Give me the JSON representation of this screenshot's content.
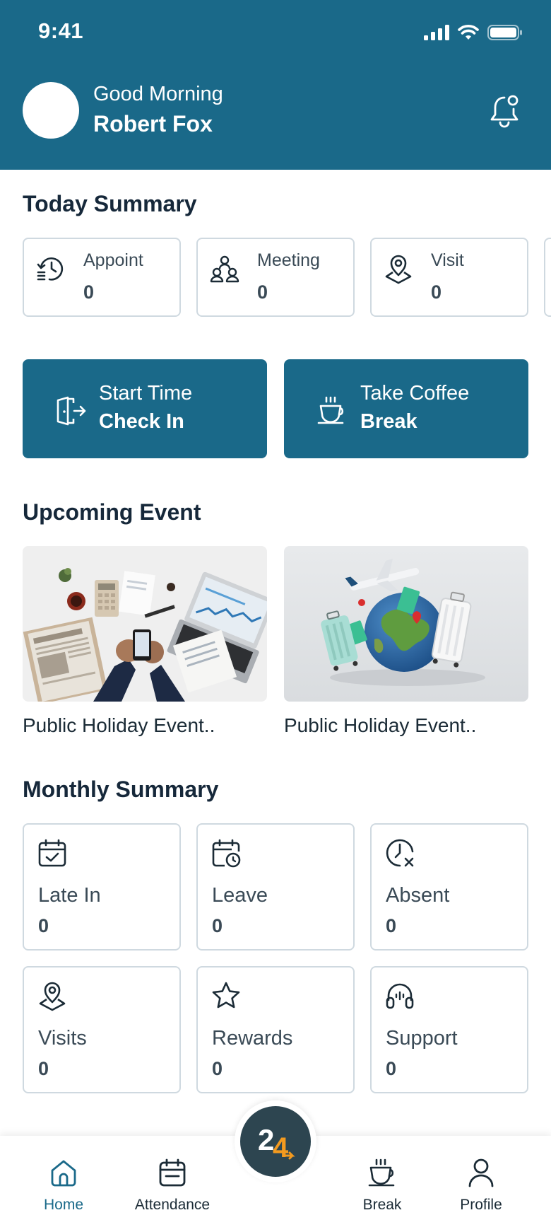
{
  "status_bar": {
    "time": "9:41"
  },
  "header": {
    "greeting": "Good Morning",
    "name": "Robert Fox"
  },
  "today_summary": {
    "title": "Today Summary",
    "cards": [
      {
        "label": "Appoint",
        "value": "0",
        "icon": "appointment-clock-icon"
      },
      {
        "label": "Meeting",
        "value": "0",
        "icon": "meeting-people-icon"
      },
      {
        "label": "Visit",
        "value": "0",
        "icon": "map-pin-icon"
      }
    ]
  },
  "actions": {
    "check_in": {
      "line1": "Start Time",
      "line2": "Check In",
      "icon": "door-exit-icon"
    },
    "break": {
      "line1": "Take Coffee",
      "line2": "Break",
      "icon": "coffee-cup-icon"
    }
  },
  "upcoming_event": {
    "title": "Upcoming Event",
    "events": [
      {
        "title": "Public Holiday Event..",
        "image": "desk-business-photo"
      },
      {
        "title": "Public Holiday Event..",
        "image": "travel-globe-photo"
      }
    ]
  },
  "monthly_summary": {
    "title": "Monthly Summary",
    "cards": [
      {
        "label": "Late In",
        "value": "0",
        "icon": "calendar-check-icon"
      },
      {
        "label": "Leave",
        "value": "0",
        "icon": "calendar-clock-icon"
      },
      {
        "label": "Absent",
        "value": "0",
        "icon": "clock-x-icon"
      },
      {
        "label": "Visits",
        "value": "0",
        "icon": "map-pin-icon"
      },
      {
        "label": "Rewards",
        "value": "0",
        "icon": "star-icon"
      },
      {
        "label": "Support",
        "value": "0",
        "icon": "headset-icon"
      }
    ]
  },
  "tabbar": {
    "items": [
      {
        "label": "Home",
        "icon": "home-icon",
        "active": true
      },
      {
        "label": "Attendance",
        "icon": "calendar-icon",
        "active": false
      },
      {
        "label": "Break",
        "icon": "coffee-cup-icon",
        "active": false
      },
      {
        "label": "Profile",
        "icon": "user-icon",
        "active": false
      }
    ],
    "center_logo": "24"
  },
  "colors": {
    "primary": "#1a6989",
    "border": "#cfd9e0",
    "text": "#1b2b36",
    "logo_orange": "#f39a1f"
  }
}
